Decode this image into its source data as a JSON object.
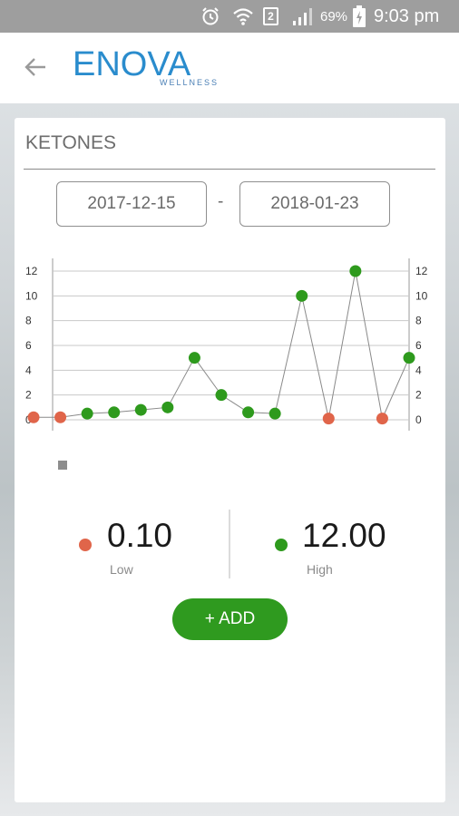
{
  "status_bar": {
    "sim_slot": "2",
    "battery_percent": "69%",
    "time": "9:03 pm",
    "icons": [
      "alarm-icon",
      "wifi-icon",
      "sim-icon",
      "signal-icon",
      "battery-charging-icon"
    ]
  },
  "header": {
    "back_icon": "back-arrow-icon",
    "logo_text": "ENOVA",
    "logo_subtext": "WELLNESS"
  },
  "card": {
    "title": "KETONES",
    "date_from": "2017-12-15",
    "date_separator": "-",
    "date_to": "2018-01-23"
  },
  "stats": {
    "low": {
      "value": "0.10",
      "label": "Low",
      "color": "#e0654a"
    },
    "high": {
      "value": "12.00",
      "label": "High",
      "color": "#2e9a1d"
    }
  },
  "add_button": {
    "label": "+ ADD"
  },
  "colors": {
    "low_point": "#e0654a",
    "normal_point": "#2e9a1d",
    "line": "#8a8a8a",
    "grid": "#c8c8c8",
    "add_button": "#2f9a1f",
    "logo": "#2a8ccd"
  },
  "chart_data": {
    "type": "scatter",
    "ylim": [
      0,
      12
    ],
    "yticks": [
      "0",
      "2",
      "4",
      "6",
      "8",
      "10",
      "12"
    ],
    "grid": true,
    "connected_line": true,
    "points": [
      {
        "y": 0.2,
        "status": "low"
      },
      {
        "y": 0.2,
        "status": "low"
      },
      {
        "y": 0.5,
        "status": "normal"
      },
      {
        "y": 0.6,
        "status": "normal"
      },
      {
        "y": 0.8,
        "status": "normal"
      },
      {
        "y": 1.0,
        "status": "normal"
      },
      {
        "y": 5.0,
        "status": "normal"
      },
      {
        "y": 2.0,
        "status": "normal"
      },
      {
        "y": 0.6,
        "status": "normal"
      },
      {
        "y": 0.5,
        "status": "normal"
      },
      {
        "y": 10.0,
        "status": "normal"
      },
      {
        "y": 0.1,
        "status": "low"
      },
      {
        "y": 12.0,
        "status": "normal"
      },
      {
        "y": 0.1,
        "status": "low"
      },
      {
        "y": 5.0,
        "status": "normal"
      }
    ]
  }
}
